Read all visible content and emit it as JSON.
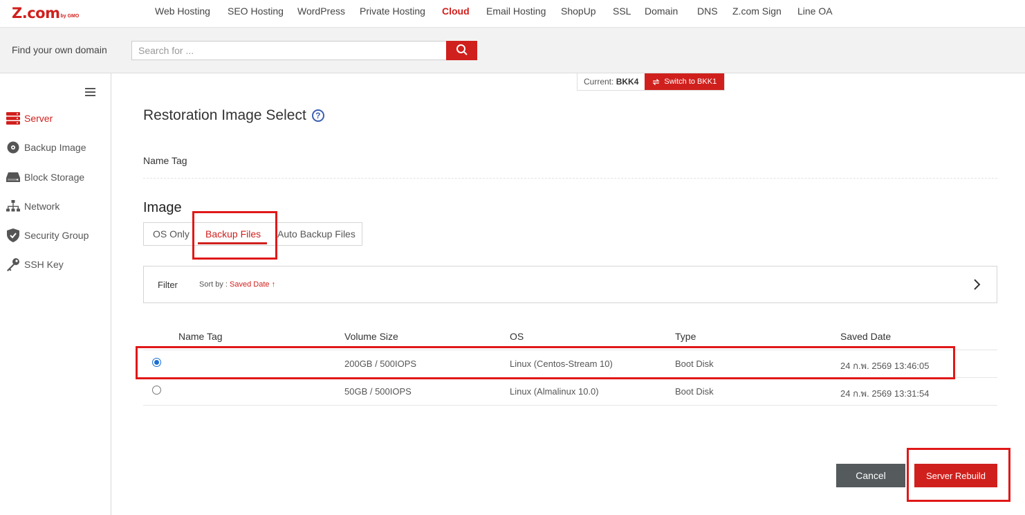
{
  "logo": {
    "main": "Z.com",
    "sub": "by GMO"
  },
  "topnav": {
    "items": [
      {
        "label": "Web Hosting",
        "active": false
      },
      {
        "label": "SEO Hosting",
        "active": false
      },
      {
        "label": "WordPress",
        "active": false
      },
      {
        "label": "Private Hosting",
        "active": false
      },
      {
        "label": "Cloud",
        "active": true
      },
      {
        "label": "Email Hosting",
        "active": false
      },
      {
        "label": "ShopUp",
        "active": false
      },
      {
        "label": "SSL",
        "active": false
      },
      {
        "label": "Domain",
        "active": false
      },
      {
        "label": "DNS",
        "active": false
      },
      {
        "label": "Z.com Sign",
        "active": false
      },
      {
        "label": "Line OA",
        "active": false
      }
    ]
  },
  "domain_search": {
    "label": "Find your own domain",
    "placeholder": "Search for ...",
    "value": ""
  },
  "sidebar": {
    "items": [
      {
        "label": "Server",
        "icon": "server-icon",
        "active": true
      },
      {
        "label": "Backup Image",
        "icon": "disc-icon",
        "active": false
      },
      {
        "label": "Block Storage",
        "icon": "storage-icon",
        "active": false
      },
      {
        "label": "Network",
        "icon": "network-icon",
        "active": false
      },
      {
        "label": "Security Group",
        "icon": "shield-icon",
        "active": false
      },
      {
        "label": "SSH Key",
        "icon": "key-icon",
        "active": false
      }
    ]
  },
  "region": {
    "current_label": "Current:",
    "current_value": "BKK4",
    "switch_label": "Switch to BKK1"
  },
  "page": {
    "title": "Restoration Image Select",
    "help": "?",
    "name_tag_label": "Name Tag"
  },
  "image_section": {
    "title": "Image",
    "tabs": [
      {
        "label": "OS Only",
        "active": false
      },
      {
        "label": "Backup Files",
        "active": true
      },
      {
        "label": "Auto Backup Files",
        "active": false
      }
    ]
  },
  "filter": {
    "label": "Filter",
    "sort_prefix": "Sort by : ",
    "sort_value": "Saved Date ↑"
  },
  "table": {
    "headers": [
      "Name Tag",
      "Volume Size",
      "OS",
      "Type",
      "Saved Date"
    ],
    "rows": [
      {
        "selected": true,
        "name_tag": "",
        "volume_size": "200GB / 500IOPS",
        "os": "Linux (Centos-Stream 10)",
        "type": "Boot Disk",
        "saved_date": "24 ก.พ. 2569 13:46:05"
      },
      {
        "selected": false,
        "name_tag": "",
        "volume_size": "50GB / 500IOPS",
        "os": "Linux (Almalinux 10.0)",
        "type": "Boot Disk",
        "saved_date": "24 ก.พ. 2569 13:31:54"
      }
    ]
  },
  "actions": {
    "cancel_label": "Cancel",
    "rebuild_label": "Server Rebuild"
  },
  "colors": {
    "brand_red": "#d0201d",
    "annotation_red": "#e01818",
    "radio_blue": "#1b6fd1",
    "cancel_gray": "#555a5d"
  }
}
